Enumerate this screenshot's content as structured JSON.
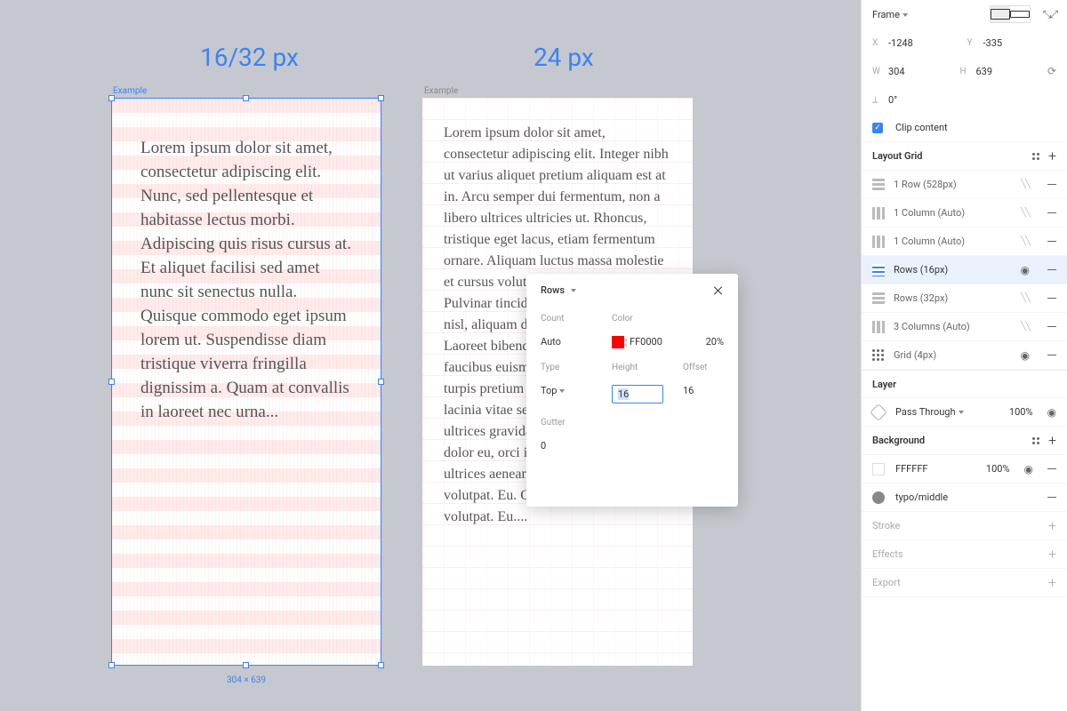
{
  "canvas": {
    "heading1": "16/32 px",
    "heading2": "24 px",
    "frame_label": "Example",
    "dimensions": "304 × 639",
    "text1": "Lorem ipsum dolor sit amet, consectetur adipiscing elit. Nunc, sed pellentesque et habitasse lectus morbi. Adipiscing quis risus cursus at. Et aliquet facilisi sed amet nunc sit senectus nulla. Quisque commodo eget ipsum lorem ut. Suspendisse diam tristique viverra fringilla dignissim a. Quam at convallis in laoreet nec urna...",
    "text2": "Lorem ipsum dolor sit amet, consectetur adipiscing elit. Integer nibh ut varius aliquet pretium aliquam est at in. Arcu semper dui fermentum, non a libero ultrices ultricies ut. Rhoncus, tristique eget lacus, etiam fermentum ornare. Aliquam luctus massa molestie et cursus volutpat et pellentesque. Pulvinar tincidunt tortor eget aliquet ut nisl, aliquam dignissim purus id. Laoreet bibendum velit fermentum faucibus euismod gravida pretium, nec turpis pretium risus, purus. Proin lacinia vitae sed nam. Dolor ante dolor ultrices gravida lacinia urna. Ipsum dolor eu, orci in fermentum euismod ultrices aenean. Quis dolor at amet, volutpat. Eu. Quis dolor at amet, volutpat. Eu...."
  },
  "popover": {
    "title": "Rows",
    "labels": {
      "count": "Count",
      "color": "Color",
      "type": "Type",
      "height": "Height",
      "offset": "Offset",
      "gutter": "Gutter"
    },
    "count": "Auto",
    "color_hex": "FF0000",
    "color_opacity": "20%",
    "type": "Top",
    "height": "16",
    "offset": "16",
    "gutter": "0"
  },
  "panel": {
    "frame_type": "Frame",
    "position": {
      "x": "-1248",
      "y": "-335"
    },
    "size": {
      "w": "304",
      "h": "639"
    },
    "rotation": "0°",
    "clip_content": "Clip content",
    "sections": {
      "layout_grid": "Layout Grid",
      "layer": "Layer",
      "background": "Background",
      "stroke": "Stroke",
      "effects": "Effects",
      "export": "Export"
    },
    "grid_items": [
      {
        "icon": "rows",
        "label": "1 Row (528px)",
        "visible": false
      },
      {
        "icon": "cols",
        "label": "1 Column (Auto)",
        "visible": false
      },
      {
        "icon": "cols",
        "label": "1 Column (Auto)",
        "visible": false
      },
      {
        "icon": "rows",
        "label": "Rows (16px)",
        "visible": true,
        "selected": true
      },
      {
        "icon": "rows",
        "label": "Rows (32px)",
        "visible": false
      },
      {
        "icon": "cols",
        "label": "3 Columns (Auto)",
        "visible": false
      },
      {
        "icon": "dots",
        "label": "Grid (4px)",
        "visible": true
      }
    ],
    "layer_blend": "Pass Through",
    "layer_opacity": "100%",
    "bg_hex": "FFFFFF",
    "bg_opacity": "100%",
    "bg_style": "typo/middle"
  }
}
